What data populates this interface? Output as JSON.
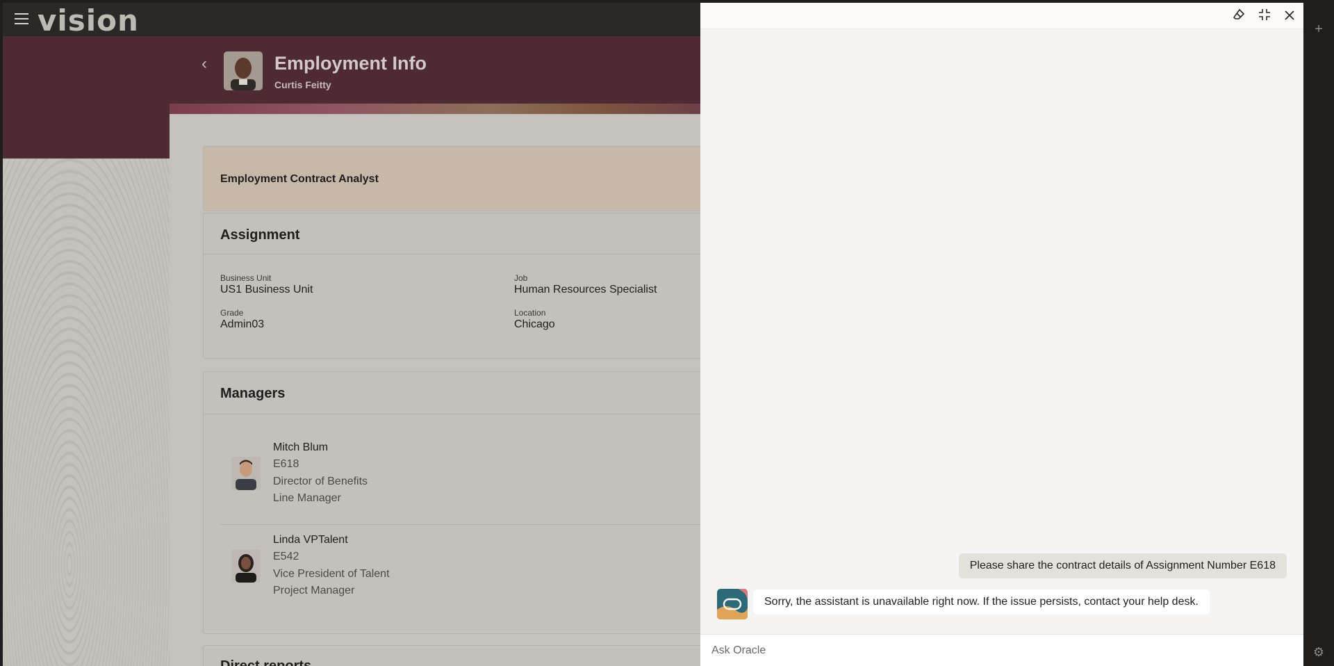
{
  "app": {
    "logo": "vision"
  },
  "header": {
    "title": "Employment Info",
    "subtitle": "Curtis Feitty"
  },
  "job": {
    "title": "Employment Contract Analyst"
  },
  "assignment": {
    "title": "Assignment",
    "fields": [
      {
        "label": "Business Unit",
        "value": "US1 Business Unit"
      },
      {
        "label": "Job",
        "value": "Human Resources Specialist"
      },
      {
        "label": "Grade",
        "value": "Admin03"
      },
      {
        "label": "Location",
        "value": "Chicago"
      }
    ]
  },
  "managers": {
    "title": "Managers",
    "items": [
      {
        "name": "Mitch Blum",
        "id": "E618",
        "title": "Director of Benefits",
        "type": "Line Manager"
      },
      {
        "name": "Linda VPTalent",
        "id": "E542",
        "title": "Vice President of Talent",
        "type": "Project Manager"
      }
    ]
  },
  "direct_reports": {
    "title": "Direct reports"
  },
  "chat": {
    "messages": [
      {
        "role": "user",
        "text": "Please share the contract details of Assignment Number E618"
      },
      {
        "role": "assistant",
        "text": "Sorry, the assistant is unavailable right now. If the issue persists, contact your help desk."
      }
    ],
    "input_placeholder": "Ask Oracle",
    "icons": {
      "clear": "eraser-icon",
      "collapse": "collapse-icon",
      "close": "close-icon"
    }
  },
  "rail": {
    "icons": [
      "plus-icon",
      "gear-icon"
    ]
  }
}
